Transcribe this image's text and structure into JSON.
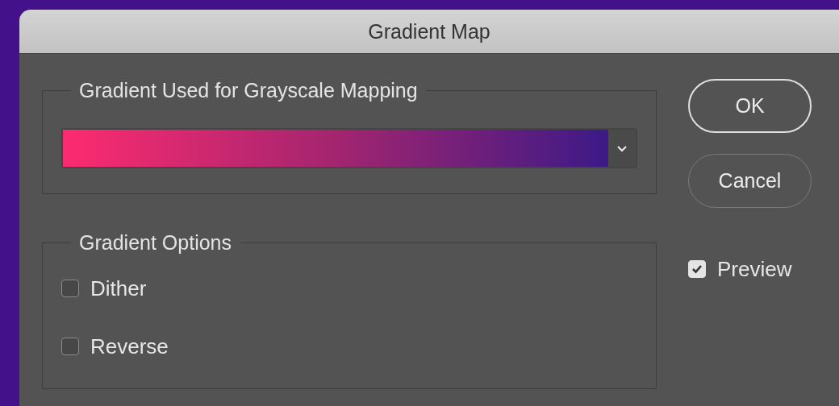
{
  "window": {
    "title": "Gradient Map"
  },
  "gradient_group": {
    "legend": "Gradient Used for Grayscale Mapping",
    "gradient": {
      "colors": [
        {
          "color": "#fd2b70"
        },
        {
          "color": "#a3256f"
        },
        {
          "color": "#3c1a87"
        }
      ]
    }
  },
  "options_group": {
    "legend": "Gradient Options",
    "options": [
      {
        "label": "Dither",
        "checked": false
      },
      {
        "label": "Reverse",
        "checked": false
      }
    ]
  },
  "buttons": [
    {
      "label": "OK",
      "kind": "default"
    },
    {
      "label": "Cancel",
      "kind": "normal"
    }
  ],
  "preview": {
    "label": "Preview",
    "checked": true
  }
}
